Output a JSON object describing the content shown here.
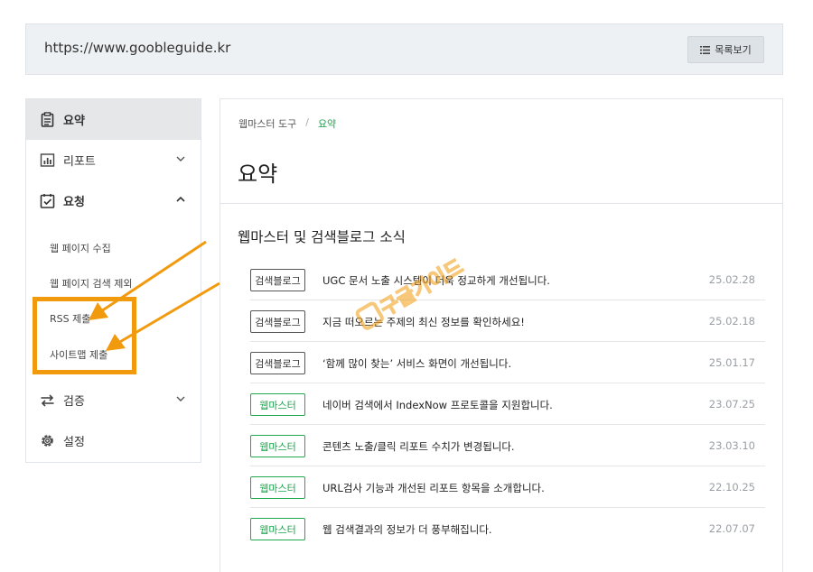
{
  "urlbar": {
    "url": "https://www.goobleguide.kr",
    "list_button": "목록보기"
  },
  "sidebar": {
    "items": [
      {
        "label": "요약",
        "icon": "clipboard-icon"
      },
      {
        "label": "리포트",
        "icon": "chart-icon"
      },
      {
        "label": "요청",
        "icon": "checklist-icon"
      },
      {
        "label": "검증",
        "icon": "swap-arrows-icon"
      },
      {
        "label": "설정",
        "icon": "gear-icon"
      }
    ],
    "sub_items": [
      "웹 페이지 수집",
      "웹 페이지 검색 제외",
      "RSS 제출",
      "사이트맵 제출"
    ]
  },
  "main": {
    "breadcrumb": {
      "parent": "웹마스터 도구",
      "separator": "/",
      "current": "요약"
    },
    "title": "요약",
    "section_title": "웹마스터 및 검색블로그 소식",
    "news": [
      {
        "badge": "검색블로그",
        "title": "UGC 문서 노출 시스템이 더욱 정교하게 개선됩니다.",
        "date": "25.02.28",
        "type": "dark"
      },
      {
        "badge": "검색블로그",
        "title": "지금 떠오르는 주제의 최신 정보를 확인하세요!",
        "date": "25.02.18",
        "type": "dark"
      },
      {
        "badge": "검색블로그",
        "title": "‘함께 많이 찾는’ 서비스 화면이 개선됩니다.",
        "date": "25.01.17",
        "type": "dark"
      },
      {
        "badge": "웹마스터",
        "title": "네이버 검색에서 IndexNow 프로토콜을 지원합니다.",
        "date": "23.07.25",
        "type": "green"
      },
      {
        "badge": "웹마스터",
        "title": "콘텐츠 노출/클릭 리포트 수치가 변경됩니다.",
        "date": "23.03.10",
        "type": "green"
      },
      {
        "badge": "웹마스터",
        "title": "URL검사 기능과 개선된 리포트 항목을 소개합니다.",
        "date": "22.10.25",
        "type": "green"
      },
      {
        "badge": "웹마스터",
        "title": "웹 검색결과의 정보가 더 풍부해집니다.",
        "date": "22.07.07",
        "type": "green"
      }
    ]
  },
  "colors": {
    "accent_green": "#1aa34a",
    "annotation_orange": "#f29a0e",
    "sidebar_active": "#e6e7e9"
  },
  "watermark": "구글가이드"
}
